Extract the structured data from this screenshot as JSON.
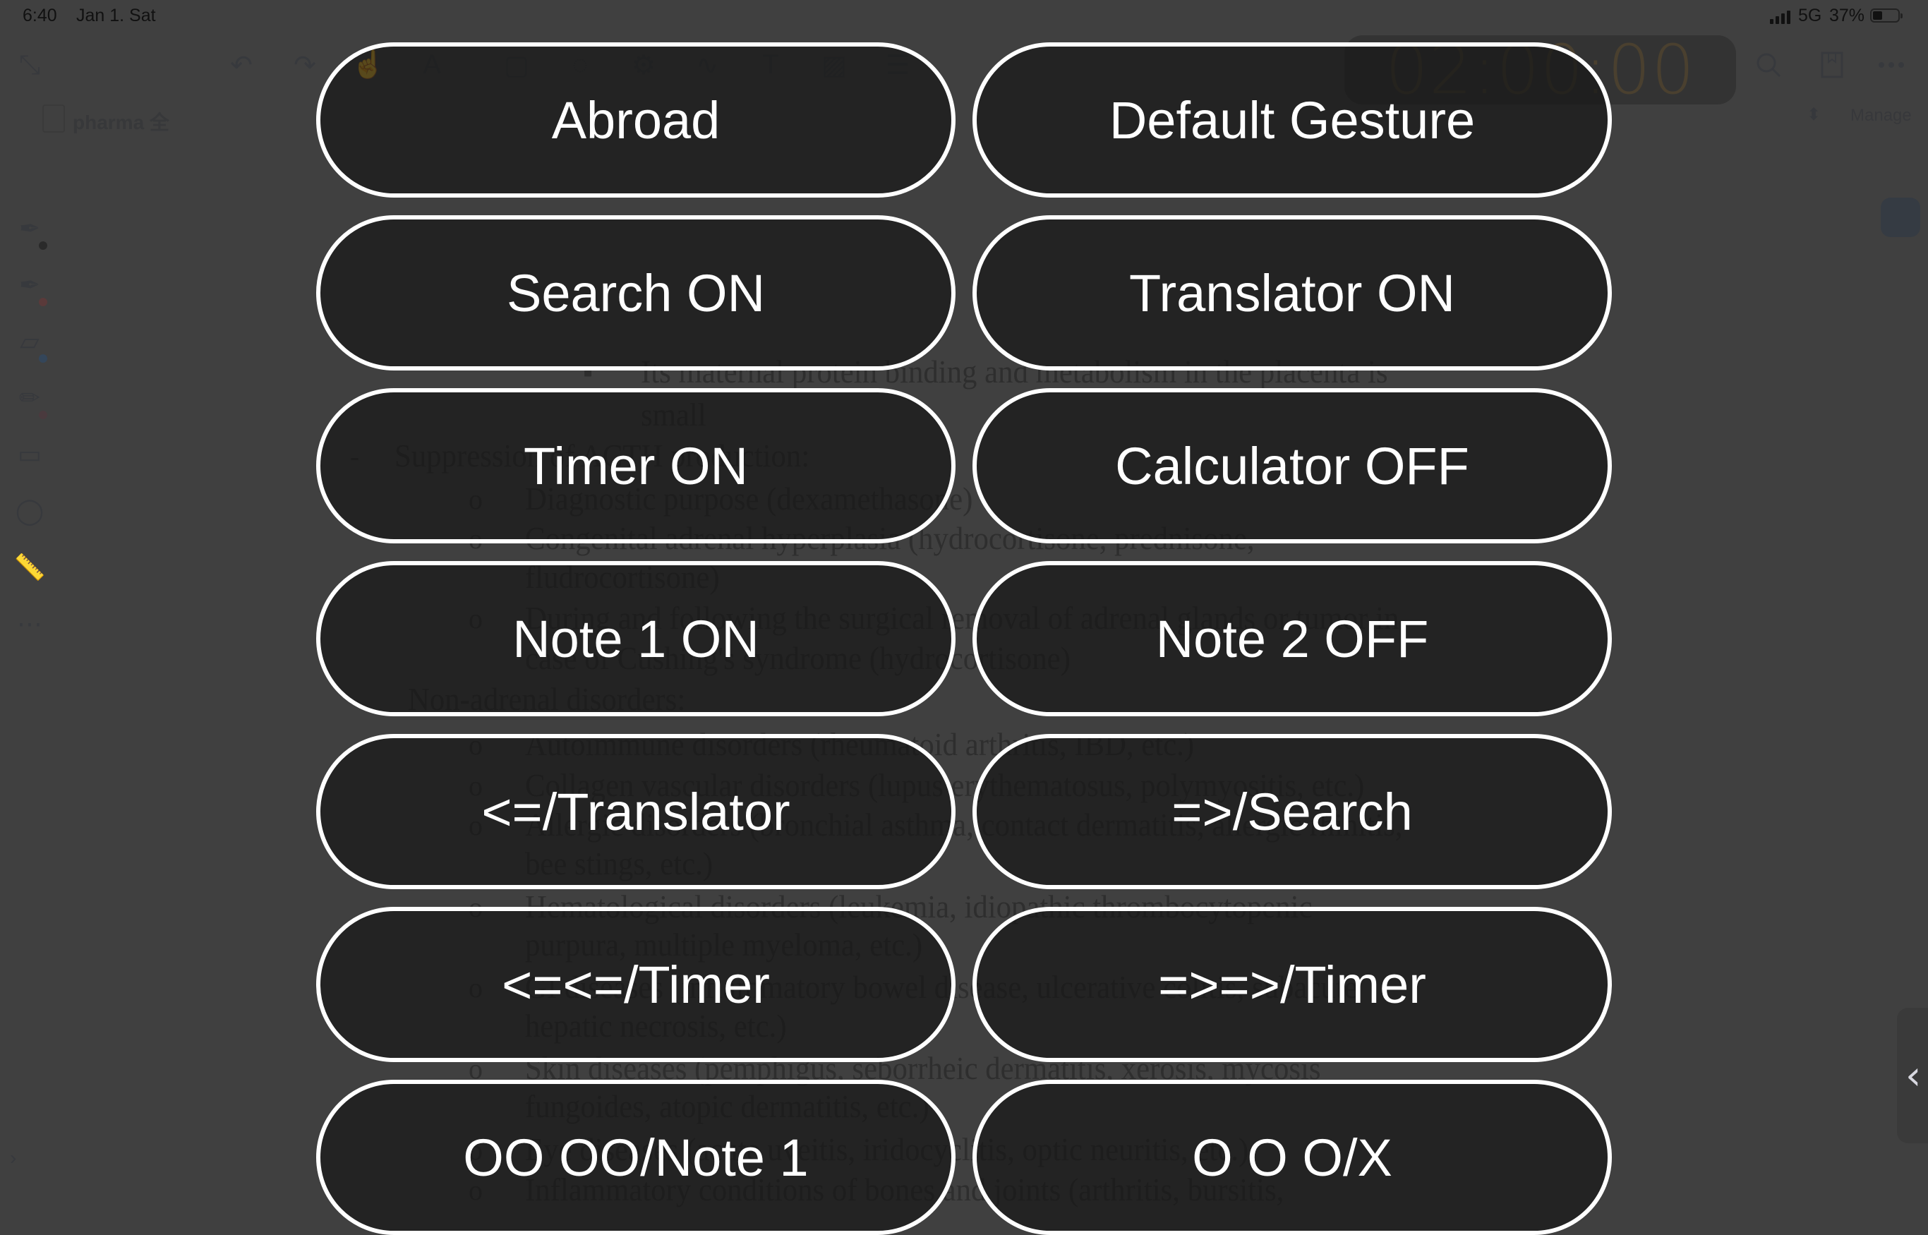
{
  "status_bar": {
    "time": "6:40",
    "date": "Jan 1. Sat",
    "network": "5G",
    "battery_percent": "37%",
    "battery_level": 0.37
  },
  "toolbar": {
    "icons": [
      "collapse-icon",
      "undo-icon",
      "redo-icon",
      "hand-pointer-icon",
      "text-color-icon",
      "crop-icon",
      "lasso-icon",
      "settings-icon",
      "scribble-icon",
      "text-box-icon",
      "image-icon",
      "list-icon"
    ],
    "timer": "02:00:00",
    "right_icons": [
      "search-icon",
      "bookmark-icon",
      "more-icon"
    ]
  },
  "document": {
    "title": "pharma 全",
    "manage_label": "Manage",
    "lines": [
      {
        "bullet": "▪",
        "text": "Its maternal protein binding and metabolism in the placenta is"
      },
      {
        "bullet": "",
        "text": "small"
      },
      {
        "bullet": "-",
        "text": "Suppression of ACTH production:"
      },
      {
        "bullet": "o",
        "text": "Diagnostic purpose (dexamethasone)"
      },
      {
        "bullet": "o",
        "text": "Congenital adrenal hyperplasia (hydrocortisone, prednisone,"
      },
      {
        "bullet": "",
        "text": "fludrocortisone)"
      },
      {
        "bullet": "o",
        "text": "During and following the surgical removal of adrenal glands or tumor in"
      },
      {
        "bullet": "",
        "text": "case of Cushing's syndrome (hydrocortisone)"
      },
      {
        "bullet": "-",
        "text": "Non-adrenal disorders:"
      },
      {
        "bullet": "o",
        "text": "Autoimmune disorders (rheumatoid arthritis, IBD, etc.)"
      },
      {
        "bullet": "o",
        "text": "Collagen vascular disorders (lupus erythematosus, polymyositis, etc.)"
      },
      {
        "bullet": "o",
        "text": "Allergic disorders (bronchial asthma, contact dermatitis, allergic rhinitis,"
      },
      {
        "bullet": "",
        "text": "bee stings, etc.)"
      },
      {
        "bullet": "o",
        "text": "Hematological disorders (leukemia, idiopathic thrombocytopenic"
      },
      {
        "bullet": "",
        "text": "purpura, multiple myeloma, etc.)"
      },
      {
        "bullet": "o",
        "text": "GI diseases (inflammatory bowel disease, ulcerative colitis, subacute"
      },
      {
        "bullet": "",
        "text": "hepatic necrosis, etc.)"
      },
      {
        "bullet": "o",
        "text": "Skin diseases (pemphigus, seborrheic dermatitis, xerosis, mycosis"
      },
      {
        "bullet": "",
        "text": "fungoides, atopic dermatitis, etc.)"
      },
      {
        "bullet": "o",
        "text": "Eye diseases (acute uveitis, iridocyclitis, optic neuritis, etc.)"
      },
      {
        "bullet": "o",
        "text": "Inflammatory conditions of bones and joints (arthritis, bursitis,"
      }
    ]
  },
  "sidebar": {
    "tools": [
      {
        "name": "fountain-pen-icon",
        "color": "#2a2a2a"
      },
      {
        "name": "fountain-pen-icon",
        "color": "#5a3a3a"
      },
      {
        "name": "highlighter-icon",
        "color": "#34465a"
      },
      {
        "name": "pencil-icon",
        "color": "#4a3a3e"
      },
      {
        "name": "eraser-icon",
        "color": ""
      },
      {
        "name": "lasso-icon",
        "color": ""
      },
      {
        "name": "ruler-icon",
        "color": ""
      },
      {
        "name": "more-icon",
        "color": ""
      }
    ]
  },
  "gesture_menu": {
    "buttons": [
      [
        "Abroad",
        "Default Gesture"
      ],
      [
        "Search ON",
        "Translator ON"
      ],
      [
        "Timer ON",
        "Calculator OFF"
      ],
      [
        "Note 1 ON",
        "Note 2 OFF"
      ],
      [
        "<=/Translator",
        "=>/Search"
      ],
      [
        "<=<=/Timer",
        "=>=>/Timer"
      ],
      [
        "OO OO/Note 1",
        "O O O/X"
      ]
    ]
  },
  "edge_handle": {
    "glyph": "‹"
  }
}
